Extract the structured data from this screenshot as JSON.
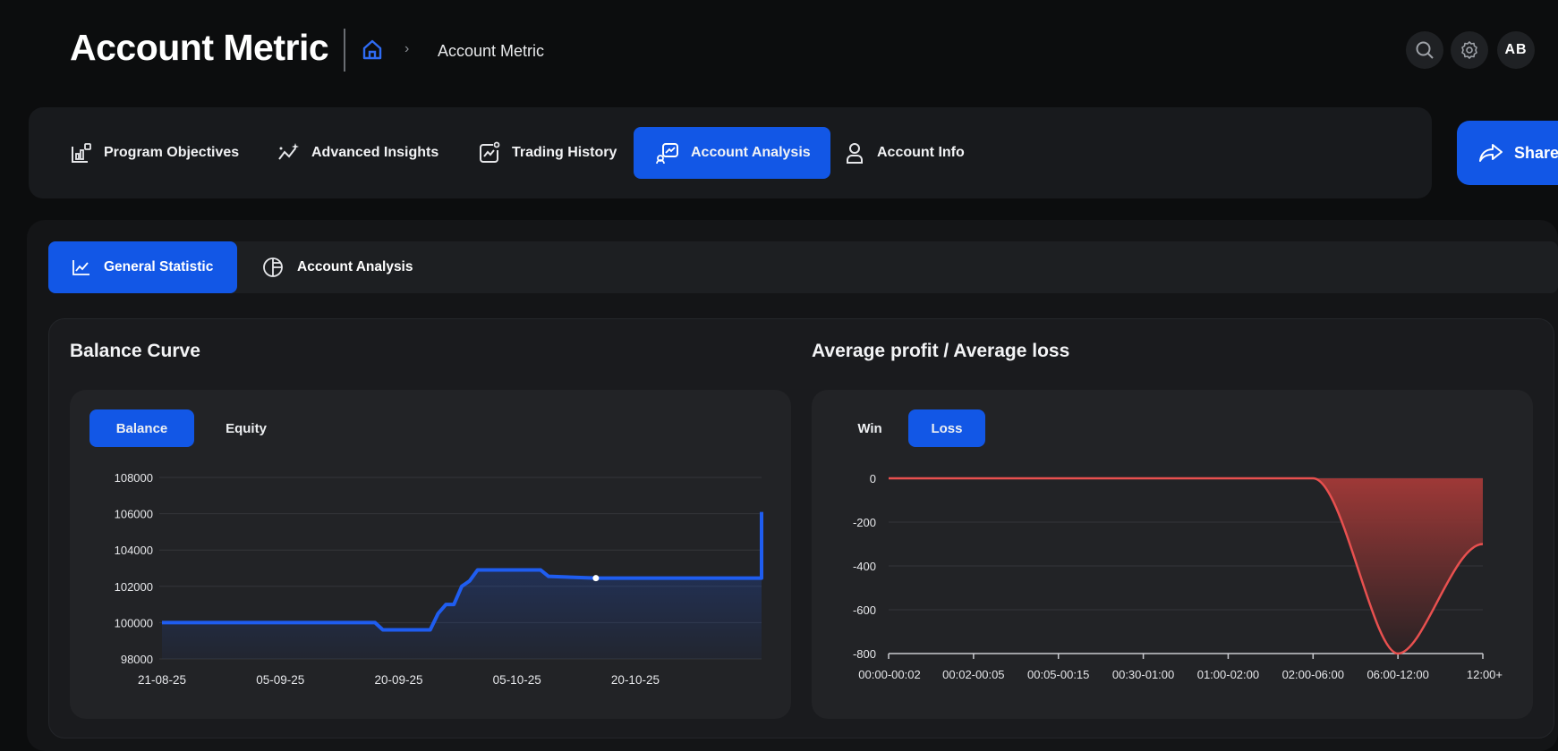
{
  "header": {
    "title": "Account Metric",
    "breadcrumb_separator": "›",
    "breadcrumb_current": "Account Metric",
    "avatar_initials": "AB"
  },
  "nav": {
    "tabs": [
      {
        "label": "Program Objectives",
        "icon": "chart-bar-icon",
        "active": false
      },
      {
        "label": "Advanced Insights",
        "icon": "sparkle-line-icon",
        "active": false
      },
      {
        "label": "Trading History",
        "icon": "chart-history-icon",
        "active": false
      },
      {
        "label": "Account Analysis",
        "icon": "analysis-icon",
        "active": true
      },
      {
        "label": "Account Info",
        "icon": "user-icon",
        "active": false
      }
    ],
    "share_label": "Share"
  },
  "subtabs": [
    {
      "label": "General Statistic",
      "icon": "line-chart-icon",
      "active": true
    },
    {
      "label": "Account Analysis",
      "icon": "pie-chart-icon",
      "active": false
    }
  ],
  "balance_panel": {
    "title": "Balance Curve",
    "toggles": [
      {
        "label": "Balance",
        "active": true
      },
      {
        "label": "Equity",
        "active": false
      }
    ]
  },
  "profit_panel": {
    "title": "Average profit / Average loss",
    "toggles": [
      {
        "label": "Win",
        "active": false
      },
      {
        "label": "Loss",
        "active": true
      }
    ]
  },
  "colors": {
    "accent": "#1257e6",
    "balance_line": "#1f5df0",
    "loss_line": "#e8504f",
    "loss_fill": "#a53a38"
  },
  "chart_data": [
    {
      "type": "area",
      "ylim": [
        98000,
        108000
      ],
      "yticks": [
        98000,
        100000,
        102000,
        104000,
        106000,
        108000
      ],
      "x_tick_labels": [
        "21-08-25",
        "05-09-25",
        "20-09-25",
        "05-10-25",
        "20-10-25"
      ],
      "grid": true,
      "series": [
        {
          "x": [
            "21-08-25",
            "28-08-25",
            "04-09-25",
            "11-09-25",
            "17-09-25",
            "18-09-25",
            "24-09-25",
            "25-09-25",
            "26-09-25",
            "27-09-25",
            "28-09-25",
            "29-09-25",
            "30-09-25",
            "01-10-25",
            "02-10-25",
            "08-10-25",
            "09-10-25",
            "15-10-25",
            "01-11-25",
            "05-11-25",
            "05-11-25"
          ],
          "values": [
            100000,
            100000,
            100000,
            100000,
            100000,
            99600,
            99600,
            100500,
            101000,
            101000,
            102000,
            102300,
            102900,
            102900,
            102900,
            102900,
            102550,
            102450,
            102450,
            102450,
            106100
          ]
        }
      ]
    },
    {
      "type": "area",
      "categories": [
        "00:00-00:02",
        "00:02-00:05",
        "00:05-00:15",
        "00:30-01:00",
        "01:00-02:00",
        "02:00-06:00",
        "06:00-12:00",
        "12:00+"
      ],
      "ylim": [
        -800,
        0
      ],
      "yticks": [
        0,
        -200,
        -400,
        -600,
        -800
      ],
      "grid": true,
      "series": [
        {
          "values": [
            0,
            0,
            0,
            0,
            0,
            0,
            -800,
            -300
          ]
        }
      ]
    }
  ]
}
